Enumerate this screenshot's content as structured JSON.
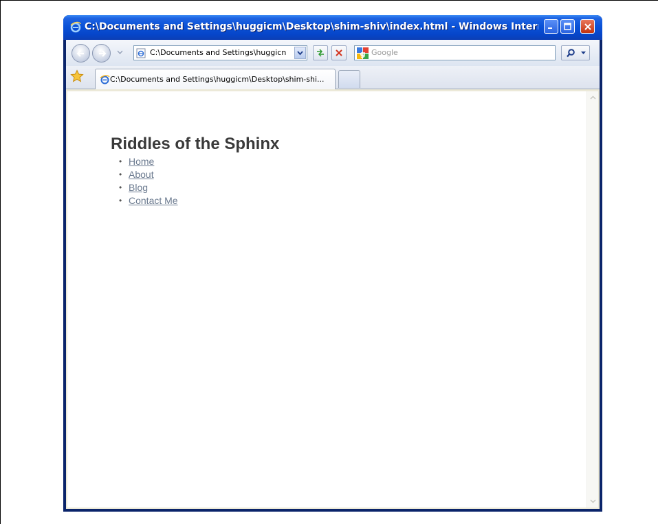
{
  "window": {
    "title": "C:\\Documents and Settings\\huggicm\\Desktop\\shim-shiv\\index.html - Windows Internet E..."
  },
  "navbar": {
    "address_value": "C:\\Documents and Settings\\huggicn",
    "search_placeholder": "Google"
  },
  "tabs": [
    {
      "label": "C:\\Documents and Settings\\huggicm\\Desktop\\shim-shi..."
    }
  ],
  "page": {
    "heading": "Riddles of the Sphinx",
    "nav": [
      {
        "label": "Home"
      },
      {
        "label": "About"
      },
      {
        "label": "Blog"
      },
      {
        "label": "Contact Me"
      }
    ]
  },
  "colors": {
    "titlebar": "#0a52d8",
    "link": "#6b7a8f",
    "heading": "#3a3a3a",
    "close_button": "#c3330f"
  },
  "icons": [
    "ie-icon",
    "back-icon",
    "forward-icon",
    "refresh-icon",
    "stop-icon",
    "google-icon",
    "search-icon",
    "favorites-star-icon",
    "minimize-icon",
    "maximize-icon",
    "close-icon"
  ]
}
